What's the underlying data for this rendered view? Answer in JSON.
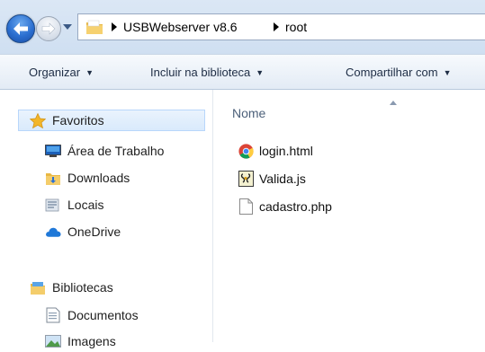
{
  "address_bar": {
    "breadcrumbs": [
      "USBWebserver v8.6",
      "root"
    ]
  },
  "toolbar": {
    "organize_label": "Organizar",
    "include_library_label": "Incluir na biblioteca",
    "share_label": "Compartilhar com"
  },
  "nav_pane": {
    "favorites_label": "Favoritos",
    "favorites_items": [
      {
        "label": "Área de Trabalho",
        "icon": "desktop-icon"
      },
      {
        "label": "Downloads",
        "icon": "downloads-folder-icon"
      },
      {
        "label": "Locais",
        "icon": "recent-places-icon"
      },
      {
        "label": "OneDrive",
        "icon": "cloud-icon"
      }
    ],
    "libraries_label": "Bibliotecas",
    "libraries_items": [
      {
        "label": "Documentos",
        "icon": "document-icon"
      },
      {
        "label": "Imagens",
        "icon": "pictures-icon"
      }
    ]
  },
  "content": {
    "column_header": "Nome",
    "files": [
      {
        "name": "login.html",
        "icon": "chrome-html-icon"
      },
      {
        "name": "Valida.js",
        "icon": "script-file-icon"
      },
      {
        "name": "cadastro.php",
        "icon": "blank-file-icon"
      }
    ]
  },
  "colors": {
    "address_bg": "#dbe7f5",
    "toolbar_text": "#1e2d45",
    "selection_bg": "#d9eafc",
    "header_text": "#4c607a"
  }
}
